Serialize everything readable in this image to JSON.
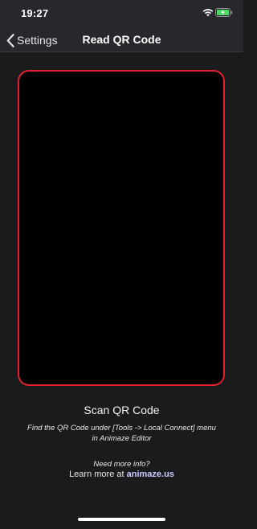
{
  "status_bar": {
    "time": "19:27",
    "icons": [
      "wifi-icon",
      "battery-charging-icon"
    ],
    "battery_color": "#4cd964"
  },
  "nav": {
    "back_label": "Settings",
    "title": "Read QR Code",
    "back_icon": "chevron-left-icon"
  },
  "scanner": {
    "frame_color": "#e3202f"
  },
  "content": {
    "scan_title": "Scan QR Code",
    "instructions": "Find the QR Code under [Tools -> Local Connect] menu in Animaze Editor",
    "need_more_info": "Need more info?",
    "learn_more_prefix": "Learn more at ",
    "learn_more_link": "animaze.us"
  }
}
